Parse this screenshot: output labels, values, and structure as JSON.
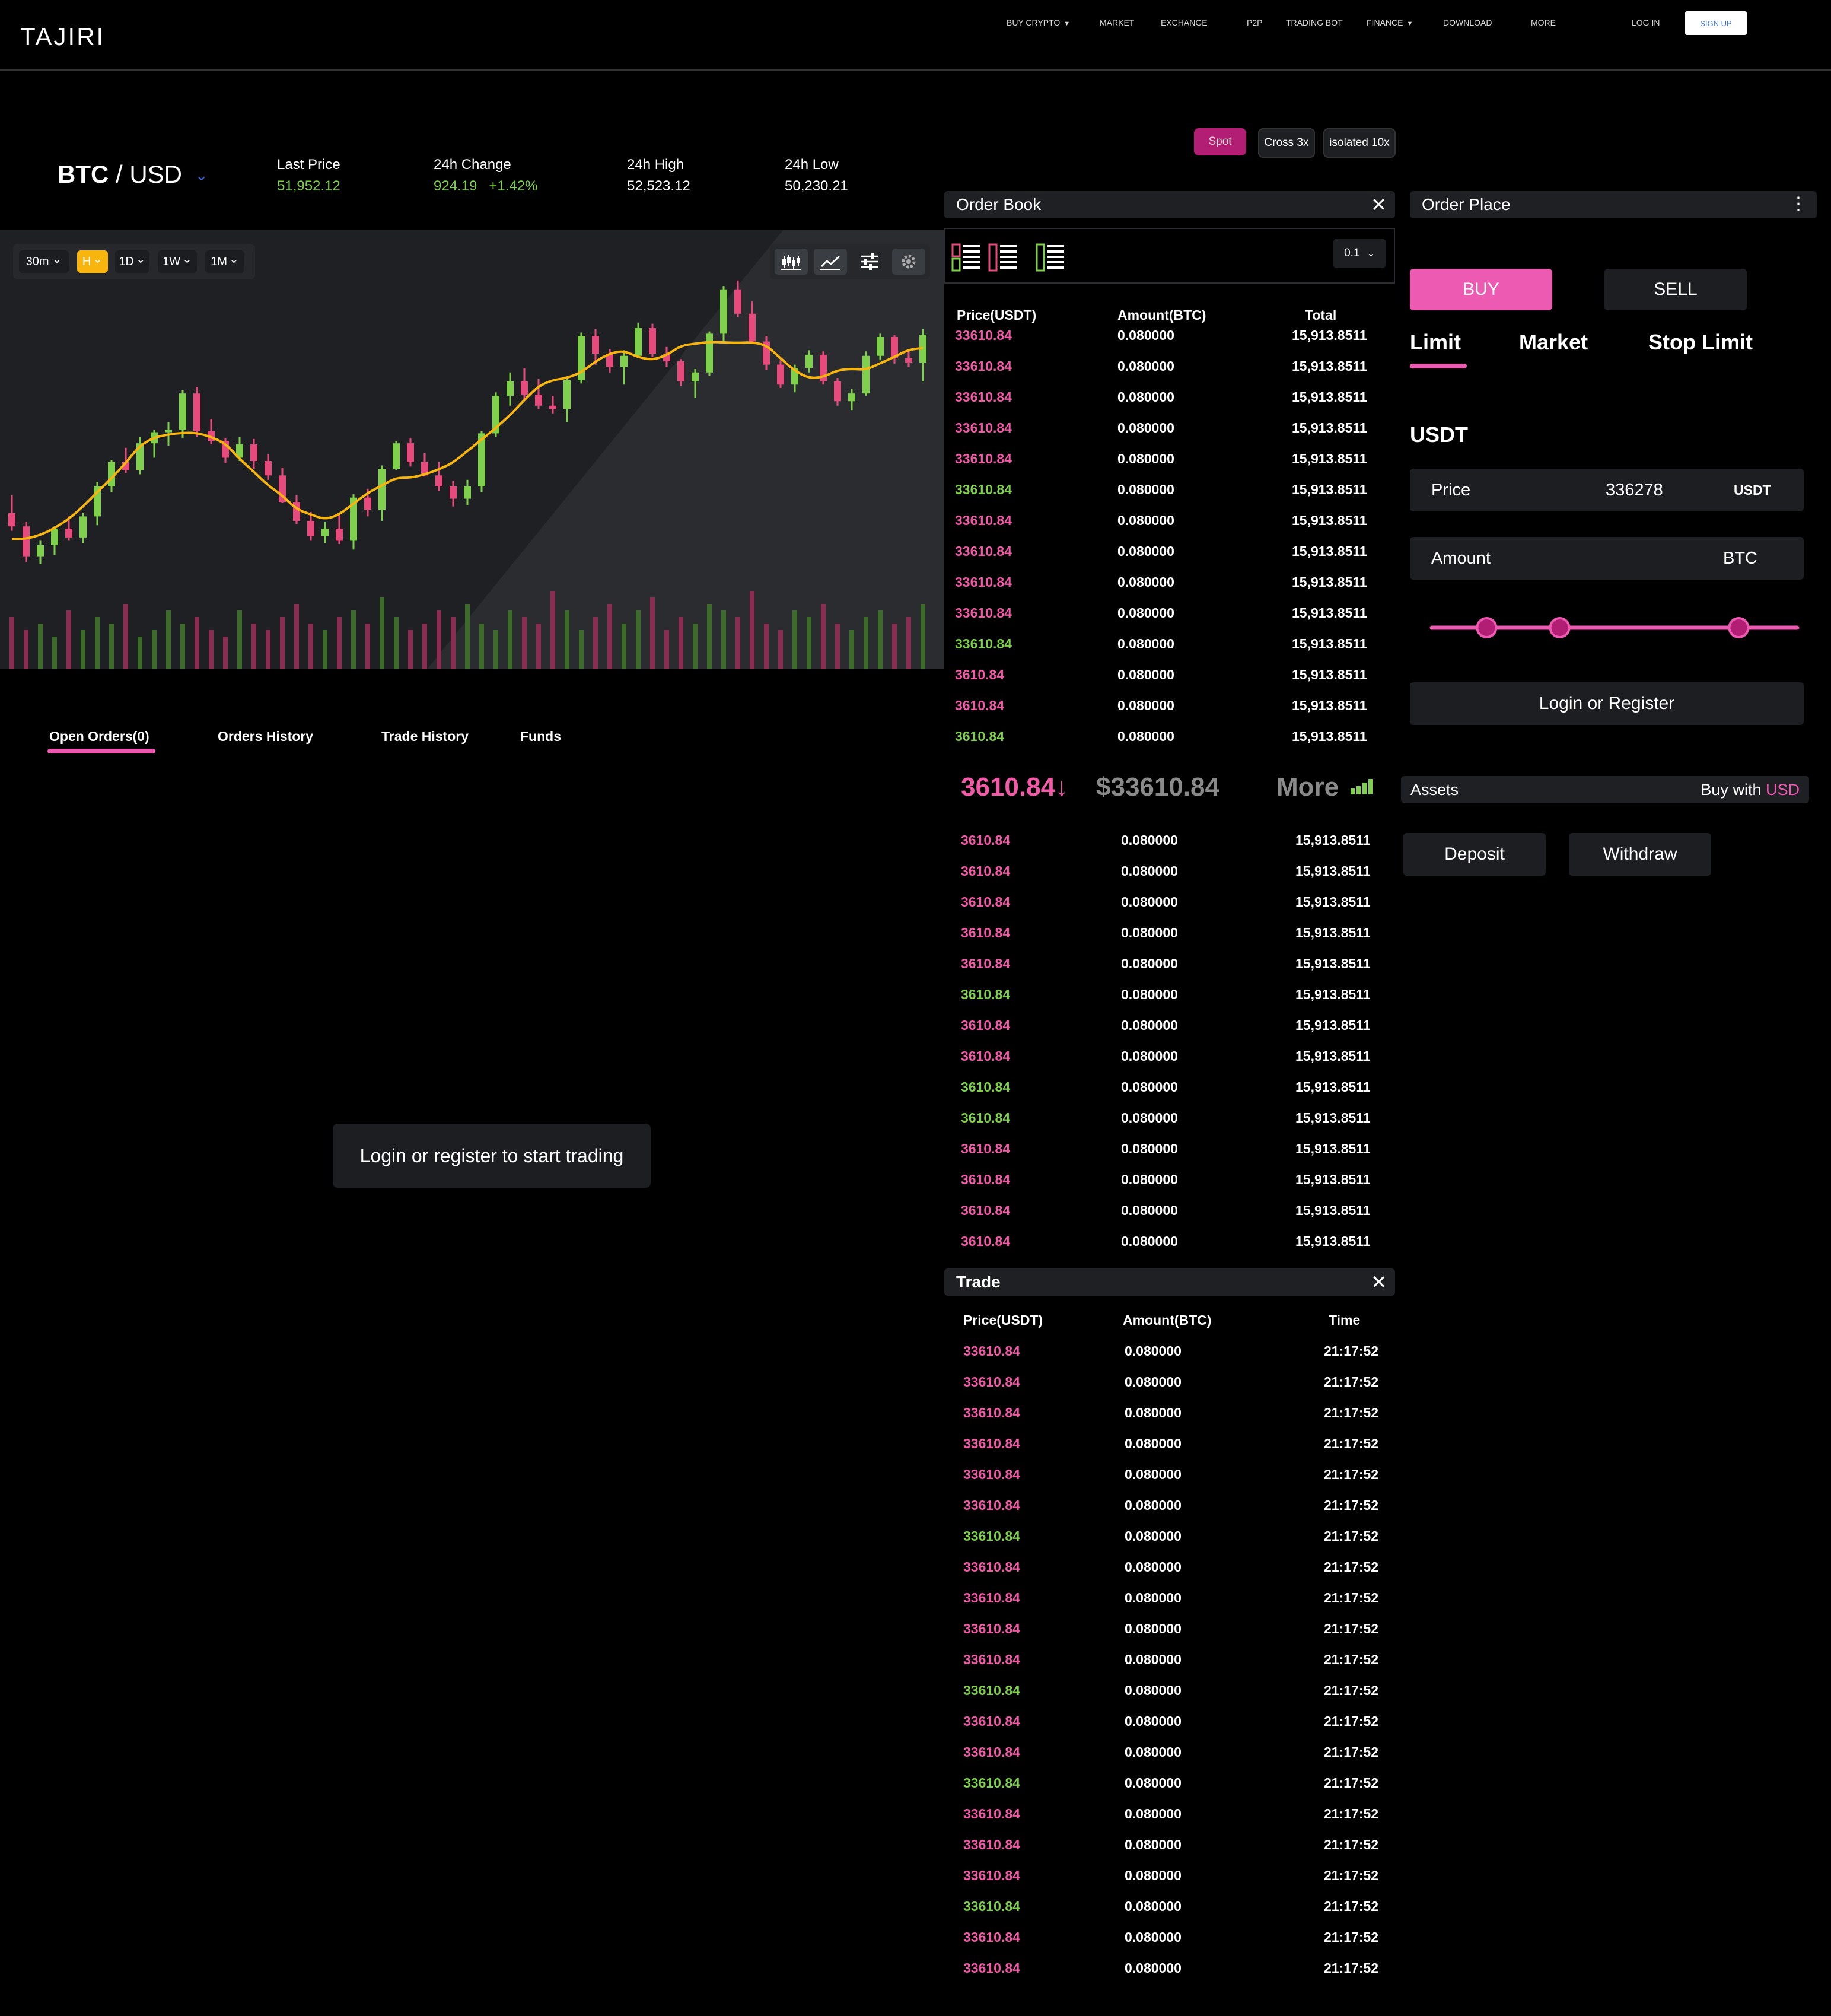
{
  "app": {
    "logo": "TAJIRI"
  },
  "nav": {
    "items": [
      {
        "label": "BUY CRYPTO",
        "caret": "▼"
      },
      {
        "label": "MARKET"
      },
      {
        "label": "EXCHANGE"
      },
      {
        "label": "P2P"
      },
      {
        "label": "TRADING BOT"
      },
      {
        "label": "FINANCE",
        "caret": "▼"
      },
      {
        "label": "DOWNLOAD"
      },
      {
        "label": "MORE"
      }
    ],
    "login": "LOG IN",
    "signup": "SIGN UP"
  },
  "ticker": {
    "base": "BTC",
    "quote": "/ USD",
    "stats": [
      {
        "label": "Last Price",
        "value": "51,952.12",
        "color": "#7fd04c"
      },
      {
        "label": "24h Change",
        "value": "924.19   +1.42%",
        "color": "#7fd04c"
      },
      {
        "label": "24h High",
        "value": "52,523.12",
        "color": "#ffffff"
      },
      {
        "label": "24h Low",
        "value": "50,230.21",
        "color": "#ffffff"
      }
    ]
  },
  "modes": [
    "Spot",
    "Cross 3x",
    "isolated 10x"
  ],
  "chart": {
    "timeframes": [
      {
        "label": "30m",
        "caret": "⌄"
      },
      {
        "label": "H",
        "caret": "⌄",
        "active": true
      },
      {
        "label": "1D",
        "caret": "⌄"
      },
      {
        "label": "1W",
        "caret": "⌄"
      },
      {
        "label": "1M",
        "caret": "⌄"
      }
    ],
    "tools": [
      "candles-icon",
      "line-chart-icon",
      "sliders-icon",
      "gear-icon"
    ],
    "colors": {
      "up": "#7fd04c",
      "down": "#e64b7e",
      "ma": "#f7b50e"
    }
  },
  "chart_data": {
    "type": "candlestick",
    "ohlc": [
      [
        36.6,
        38.2,
        35.0,
        35.4
      ],
      [
        35.4,
        35.8,
        32.2,
        32.7
      ],
      [
        32.7,
        34.1,
        32.0,
        33.7
      ],
      [
        33.7,
        35.4,
        32.8,
        35.2
      ],
      [
        35.2,
        36.3,
        34.1,
        34.4
      ],
      [
        34.4,
        36.6,
        33.9,
        36.3
      ],
      [
        36.3,
        39.4,
        35.5,
        39.0
      ],
      [
        39.0,
        41.4,
        38.5,
        41.2
      ],
      [
        41.2,
        42.5,
        40.2,
        40.5
      ],
      [
        40.5,
        43.5,
        40.1,
        42.9
      ],
      [
        42.9,
        44.1,
        41.6,
        43.9
      ],
      [
        43.9,
        44.8,
        42.7,
        44.1
      ],
      [
        44.1,
        47.7,
        43.4,
        47.4
      ],
      [
        47.4,
        48.0,
        43.5,
        44.0
      ],
      [
        44.0,
        45.1,
        42.8,
        43.1
      ],
      [
        43.1,
        43.4,
        41.1,
        41.6
      ],
      [
        41.6,
        43.5,
        41.3,
        42.8
      ],
      [
        42.8,
        43.3,
        40.6,
        41.3
      ],
      [
        41.3,
        41.9,
        39.6,
        40.0
      ],
      [
        40.0,
        40.7,
        37.5,
        37.6
      ],
      [
        37.6,
        38.2,
        35.6,
        35.9
      ],
      [
        35.9,
        36.7,
        34.1,
        34.5
      ],
      [
        34.5,
        35.8,
        33.9,
        35.2
      ],
      [
        35.2,
        36.5,
        33.8,
        34.1
      ],
      [
        34.1,
        38.3,
        33.3,
        38.0
      ],
      [
        38.0,
        38.8,
        36.3,
        36.9
      ],
      [
        36.9,
        40.9,
        35.9,
        40.6
      ],
      [
        40.6,
        43.1,
        40.5,
        42.9
      ],
      [
        42.9,
        43.4,
        40.8,
        41.2
      ],
      [
        41.2,
        42.0,
        39.9,
        40.0
      ],
      [
        40.0,
        41.2,
        38.6,
        39.0
      ],
      [
        39.0,
        39.5,
        37.2,
        37.9
      ],
      [
        37.9,
        39.6,
        37.3,
        39.0
      ],
      [
        39.0,
        44.0,
        38.5,
        43.8
      ],
      [
        43.8,
        47.5,
        43.5,
        47.2
      ],
      [
        47.2,
        49.3,
        46.3,
        48.5
      ],
      [
        48.5,
        49.7,
        46.8,
        47.3
      ],
      [
        47.3,
        48.7,
        46.0,
        46.3
      ],
      [
        46.3,
        47.2,
        45.6,
        46.0
      ],
      [
        46.0,
        48.9,
        44.8,
        48.6
      ],
      [
        48.6,
        52.9,
        48.3,
        52.6
      ],
      [
        52.6,
        53.2,
        50.0,
        51.0
      ],
      [
        51.0,
        51.4,
        49.3,
        49.8
      ],
      [
        49.8,
        51.3,
        48.2,
        50.8
      ],
      [
        50.8,
        53.8,
        50.6,
        53.3
      ],
      [
        53.3,
        53.7,
        50.7,
        51.0
      ],
      [
        51.0,
        51.6,
        49.8,
        50.3
      ],
      [
        50.3,
        50.5,
        48.1,
        48.5
      ],
      [
        48.5,
        49.6,
        47.0,
        49.3
      ],
      [
        49.3,
        53.0,
        49.0,
        52.8
      ],
      [
        52.8,
        57.1,
        52.1,
        56.8
      ],
      [
        56.8,
        57.6,
        54.3,
        54.6
      ],
      [
        54.6,
        55.7,
        51.9,
        52.1
      ],
      [
        52.1,
        52.6,
        49.5,
        50.0
      ],
      [
        50.0,
        50.4,
        47.9,
        48.2
      ],
      [
        48.2,
        50.0,
        47.5,
        49.7
      ],
      [
        49.7,
        51.3,
        49.3,
        50.9
      ],
      [
        50.9,
        51.2,
        48.2,
        48.5
      ],
      [
        48.5,
        48.8,
        46.3,
        46.7
      ],
      [
        46.7,
        47.8,
        45.9,
        47.4
      ],
      [
        47.4,
        51.2,
        47.2,
        50.8
      ],
      [
        50.8,
        52.8,
        50.4,
        52.5
      ],
      [
        52.5,
        52.7,
        50.1,
        50.6
      ],
      [
        50.6,
        51.3,
        49.8,
        50.2
      ],
      [
        50.2,
        53.2,
        48.5,
        52.7
      ]
    ],
    "volume": [
      8,
      6,
      7,
      5,
      9,
      6,
      8,
      7,
      10,
      5,
      6,
      9,
      7,
      8,
      6,
      5,
      9,
      7,
      6,
      8,
      10,
      7,
      6,
      8,
      9,
      7,
      11,
      8,
      6,
      7,
      9,
      8,
      10,
      7,
      6,
      9,
      8,
      7,
      12,
      9,
      6,
      8,
      10,
      7,
      9,
      11,
      6,
      8,
      7,
      10,
      9,
      8,
      12,
      7,
      6,
      9,
      8,
      10,
      7,
      6,
      8,
      9,
      7,
      8,
      10
    ]
  },
  "order_book": {
    "title": "Order Book",
    "precision": "0.1",
    "headers": {
      "price": "Price(USDT)",
      "amount": "Amount(BTC)",
      "total": "Total"
    },
    "asks": [
      {
        "price": "33610.84",
        "amount": "0.080000",
        "total": "15,913.8511",
        "side": "red"
      },
      {
        "price": "33610.84",
        "amount": "0.080000",
        "total": "15,913.8511",
        "side": "red"
      },
      {
        "price": "33610.84",
        "amount": "0.080000",
        "total": "15,913.8511",
        "side": "red"
      },
      {
        "price": "33610.84",
        "amount": "0.080000",
        "total": "15,913.8511",
        "side": "red"
      },
      {
        "price": "33610.84",
        "amount": "0.080000",
        "total": "15,913.8511",
        "side": "red"
      },
      {
        "price": "33610.84",
        "amount": "0.080000",
        "total": "15,913.8511",
        "side": "green"
      },
      {
        "price": "33610.84",
        "amount": "0.080000",
        "total": "15,913.8511",
        "side": "red"
      },
      {
        "price": "33610.84",
        "amount": "0.080000",
        "total": "15,913.8511",
        "side": "red"
      },
      {
        "price": "33610.84",
        "amount": "0.080000",
        "total": "15,913.8511",
        "side": "red"
      },
      {
        "price": "33610.84",
        "amount": "0.080000",
        "total": "15,913.8511",
        "side": "red"
      },
      {
        "price": "33610.84",
        "amount": "0.080000",
        "total": "15,913.8511",
        "side": "green"
      },
      {
        "price": "3610.84",
        "amount": "0.080000",
        "total": "15,913.8511",
        "side": "red"
      },
      {
        "price": "3610.84",
        "amount": "0.080000",
        "total": "15,913.8511",
        "side": "red"
      },
      {
        "price": "3610.84",
        "amount": "0.080000",
        "total": "15,913.8511",
        "side": "green"
      }
    ],
    "mid_price": "3610.84↓",
    "mid_usd": "$33610.84",
    "more": "More",
    "bids": [
      {
        "price": "3610.84",
        "amount": "0.080000",
        "total": "15,913.8511",
        "side": "red"
      },
      {
        "price": "3610.84",
        "amount": "0.080000",
        "total": "15,913.8511",
        "side": "red"
      },
      {
        "price": "3610.84",
        "amount": "0.080000",
        "total": "15,913.8511",
        "side": "red"
      },
      {
        "price": "3610.84",
        "amount": "0.080000",
        "total": "15,913.8511",
        "side": "red"
      },
      {
        "price": "3610.84",
        "amount": "0.080000",
        "total": "15,913.8511",
        "side": "red"
      },
      {
        "price": "3610.84",
        "amount": "0.080000",
        "total": "15,913.8511",
        "side": "green"
      },
      {
        "price": "3610.84",
        "amount": "0.080000",
        "total": "15,913.8511",
        "side": "red"
      },
      {
        "price": "3610.84",
        "amount": "0.080000",
        "total": "15,913.8511",
        "side": "red"
      },
      {
        "price": "3610.84",
        "amount": "0.080000",
        "total": "15,913.8511",
        "side": "green"
      },
      {
        "price": "3610.84",
        "amount": "0.080000",
        "total": "15,913.8511",
        "side": "green"
      },
      {
        "price": "3610.84",
        "amount": "0.080000",
        "total": "15,913.8511",
        "side": "red"
      },
      {
        "price": "3610.84",
        "amount": "0.080000",
        "total": "15,913.8511",
        "side": "red"
      },
      {
        "price": "3610.84",
        "amount": "0.080000",
        "total": "15,913.8511",
        "side": "red"
      },
      {
        "price": "3610.84",
        "amount": "0.080000",
        "total": "15,913.8511",
        "side": "red"
      }
    ]
  },
  "trade": {
    "title": "Trade",
    "headers": {
      "price": "Price(USDT)",
      "amount": "Amount(BTC)",
      "time": "Time"
    },
    "rows": [
      {
        "price": "33610.84",
        "amount": "0.080000",
        "time": "21:17:52",
        "side": "red"
      },
      {
        "price": "33610.84",
        "amount": "0.080000",
        "time": "21:17:52",
        "side": "red"
      },
      {
        "price": "33610.84",
        "amount": "0.080000",
        "time": "21:17:52",
        "side": "red"
      },
      {
        "price": "33610.84",
        "amount": "0.080000",
        "time": "21:17:52",
        "side": "red"
      },
      {
        "price": "33610.84",
        "amount": "0.080000",
        "time": "21:17:52",
        "side": "red"
      },
      {
        "price": "33610.84",
        "amount": "0.080000",
        "time": "21:17:52",
        "side": "red"
      },
      {
        "price": "33610.84",
        "amount": "0.080000",
        "time": "21:17:52",
        "side": "green"
      },
      {
        "price": "33610.84",
        "amount": "0.080000",
        "time": "21:17:52",
        "side": "red"
      },
      {
        "price": "33610.84",
        "amount": "0.080000",
        "time": "21:17:52",
        "side": "red"
      },
      {
        "price": "33610.84",
        "amount": "0.080000",
        "time": "21:17:52",
        "side": "red"
      },
      {
        "price": "33610.84",
        "amount": "0.080000",
        "time": "21:17:52",
        "side": "red"
      },
      {
        "price": "33610.84",
        "amount": "0.080000",
        "time": "21:17:52",
        "side": "green"
      },
      {
        "price": "33610.84",
        "amount": "0.080000",
        "time": "21:17:52",
        "side": "red"
      },
      {
        "price": "33610.84",
        "amount": "0.080000",
        "time": "21:17:52",
        "side": "red"
      },
      {
        "price": "33610.84",
        "amount": "0.080000",
        "time": "21:17:52",
        "side": "green"
      },
      {
        "price": "33610.84",
        "amount": "0.080000",
        "time": "21:17:52",
        "side": "red"
      },
      {
        "price": "33610.84",
        "amount": "0.080000",
        "time": "21:17:52",
        "side": "red"
      },
      {
        "price": "33610.84",
        "amount": "0.080000",
        "time": "21:17:52",
        "side": "red"
      },
      {
        "price": "33610.84",
        "amount": "0.080000",
        "time": "21:17:52",
        "side": "green"
      },
      {
        "price": "33610.84",
        "amount": "0.080000",
        "time": "21:17:52",
        "side": "red"
      },
      {
        "price": "33610.84",
        "amount": "0.080000",
        "time": "21:17:52",
        "side": "red"
      }
    ]
  },
  "orders": {
    "tabs": [
      "Open Orders(0)",
      "Orders History",
      "Trade History",
      "Funds"
    ],
    "empty_message": "Login or register to start trading"
  },
  "order_place": {
    "title": "Order Place",
    "buy": "BUY",
    "sell": "SELL",
    "types": [
      "Limit",
      "Market",
      "Stop Limit"
    ],
    "currency": "USDT",
    "price_label": "Price",
    "price_value": "336278",
    "price_unit": "USDT",
    "amount_label": "Amount",
    "amount_unit": "BTC",
    "slider_points": [
      0.15,
      0.35,
      0.84
    ],
    "login_register": "Login or Register"
  },
  "assets": {
    "label": "Assets",
    "buy_with": "Buy with",
    "buy_with_currency": "USD",
    "deposit": "Deposit",
    "withdraw": "Withdraw"
  }
}
